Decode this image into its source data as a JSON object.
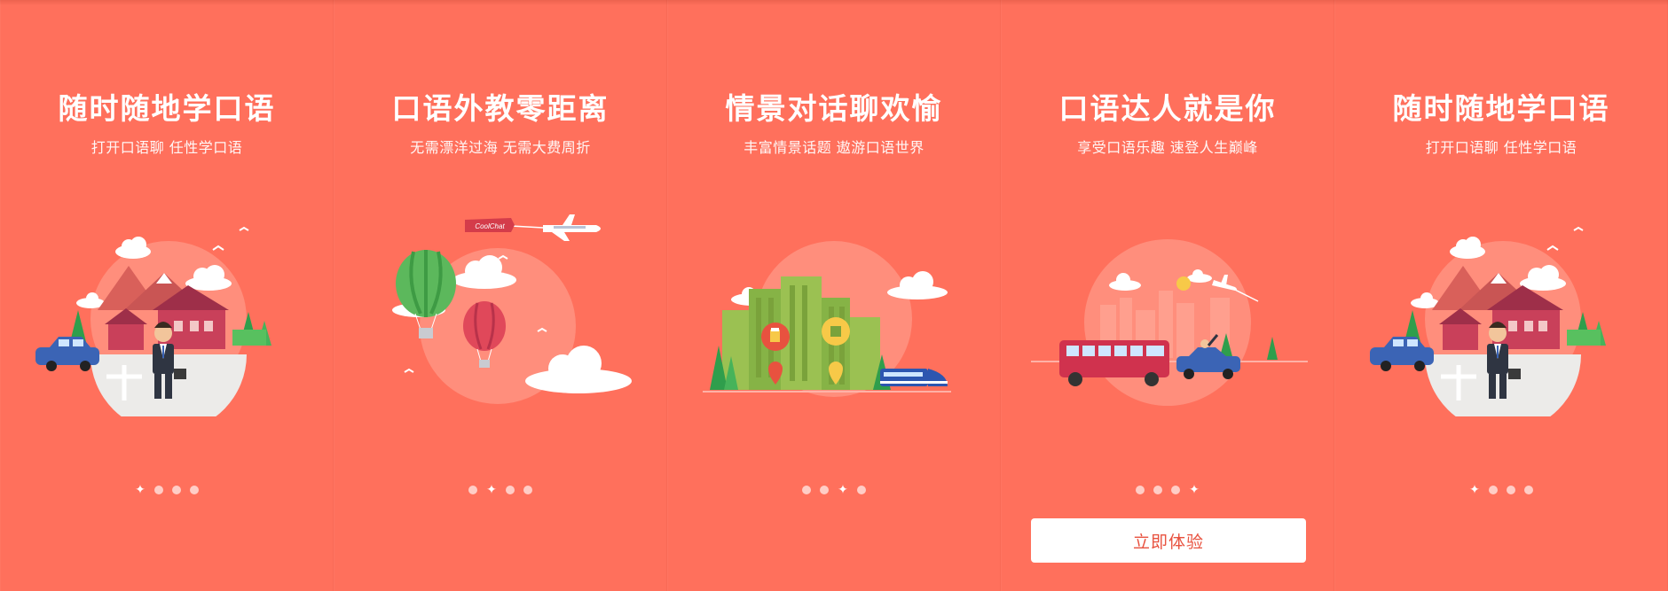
{
  "panels": [
    {
      "title": "随时随地学口语",
      "subtitle": "打开口语聊 任性学口语",
      "active_dot": 0
    },
    {
      "title": "口语外教零距离",
      "subtitle": "无需漂洋过海 无需大费周折",
      "active_dot": 1,
      "banner_text": "CoolChat"
    },
    {
      "title": "情景对话聊欢愉",
      "subtitle": "丰富情景话题 遨游口语世界",
      "active_dot": 2
    },
    {
      "title": "口语达人就是你",
      "subtitle": "享受口语乐趣 速登人生巅峰",
      "active_dot": 3,
      "button_label": "立即体验"
    },
    {
      "title": "随时随地学口语",
      "subtitle": "打开口语聊 任性学口语",
      "active_dot": 0
    }
  ],
  "colors": {
    "background": "#ff705c",
    "accent_text": "#e8523f",
    "circle": "#ff8e7c",
    "cloud": "#ffffff"
  },
  "icons": [
    "indicator-star-icon",
    "indicator-dot-icon",
    "car-icon",
    "businessman-icon",
    "hot-air-balloon-icon",
    "airplane-icon",
    "bus-icon",
    "train-icon",
    "map-pin-icon"
  ]
}
